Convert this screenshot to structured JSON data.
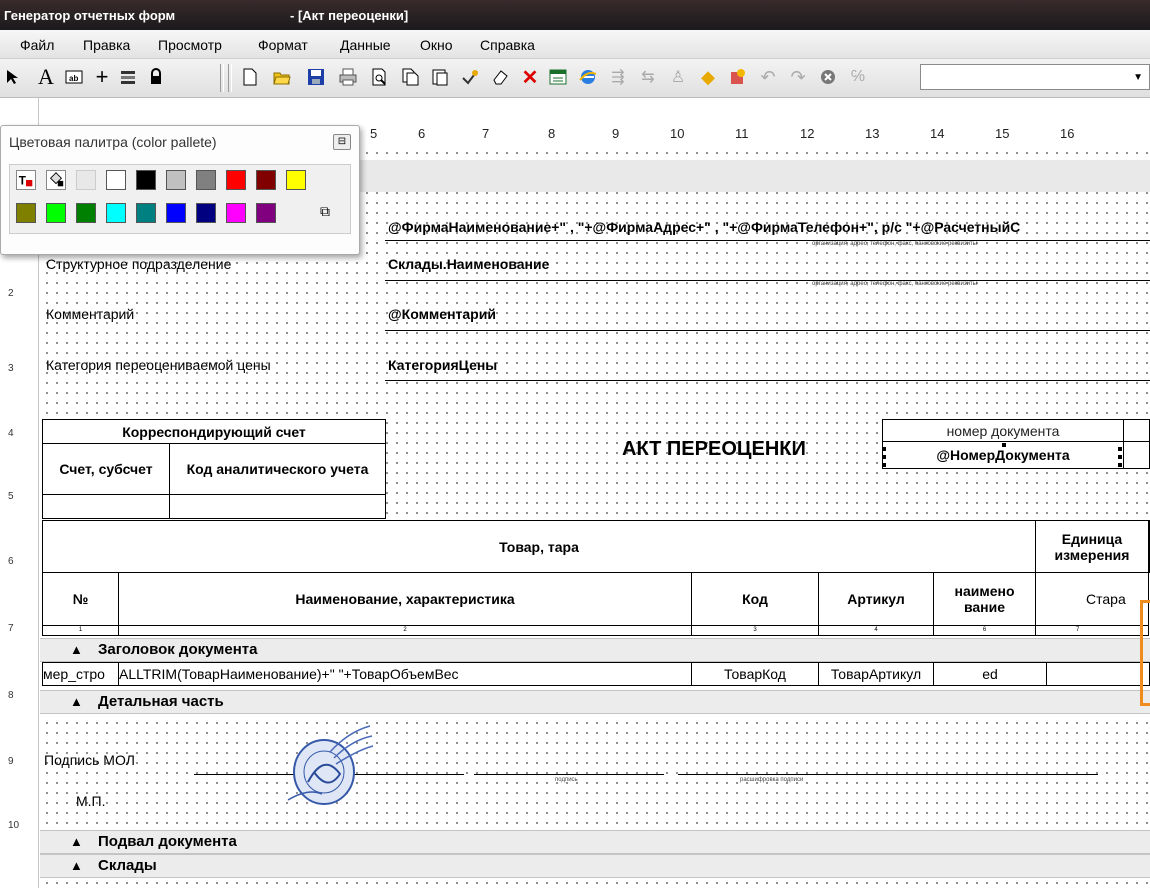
{
  "titlebar": {
    "app": "Генератор отчетных форм",
    "doc": "- [Акт переоценки]"
  },
  "menu": [
    "Файл",
    "Правка",
    "Просмотр",
    "Формат",
    "Данные",
    "Окно",
    "Справка"
  ],
  "palette": {
    "title": "Цветовая палитра (color pallete)",
    "row1": [
      "#ffffff",
      "#000000",
      "#c0c0c0",
      "#808080",
      "#ff0000",
      "#800000",
      "#ffff00"
    ],
    "row2": [
      "#808000",
      "#00ff00",
      "#008000",
      "#00ffff",
      "#008080",
      "#0000ff",
      "#000080",
      "#ff00ff",
      "#800080"
    ]
  },
  "ruler": [
    "5",
    "6",
    "7",
    "8",
    "9",
    "10",
    "11",
    "12",
    "13",
    "14",
    "15",
    "16"
  ],
  "vruler": [
    "2",
    "3",
    "4",
    "5",
    "6",
    "7",
    "8",
    "9",
    "10"
  ],
  "form": {
    "firm_expr": "@ФирмаНаименование+\" , \"+@ФирмаАдрес+\" , \"+@ФирмаТелефон+\", р/с \"+@РасчетныйС",
    "hint": "организация, адрес, телефон, факс, банковские реквизиты",
    "subdivision_label": "Структурное подразделение",
    "subdivision_value": "Склады.Наименование",
    "comment_label": "Комментарий",
    "comment_value": "@Комментарий",
    "price_cat_label": "Категория переоцениваемой цены",
    "price_cat_value": "КатегорияЦены",
    "corr_account": "Корреспондирующий счет",
    "account": "Счет, субсчет",
    "analytic": "Код аналитического учета",
    "doc_title": "АКТ ПЕРЕОЦЕНКИ",
    "doc_number_label": "номер документа",
    "doc_number_value": "@НомерДокумента",
    "goods": "Товар, тара",
    "unit": "Единица измерения",
    "no": "№",
    "name": "Наименование, характеристика",
    "code": "Код",
    "article": "Артикул",
    "unit_name": "наимено вание",
    "old": "Стара",
    "colnums": [
      "1",
      "2",
      "3",
      "4",
      "6",
      "7"
    ],
    "band_header": "Заголовок документа",
    "row_num": "мер_стро",
    "row_name": "ALLTRIM(ТоварНаименование)+\" \"+ТоварОбъемВес",
    "row_code": "ТоварКод",
    "row_article": "ТоварАртикул",
    "row_unit": "ed",
    "band_detail": "Детальная часть",
    "sign_label": "Подпись МОЛ",
    "mp": "М.П.",
    "sign_hint": "подпись",
    "sign_decode": "расшифровка подписи",
    "band_footer": "Подвал документа",
    "band_stores": "Склады"
  }
}
